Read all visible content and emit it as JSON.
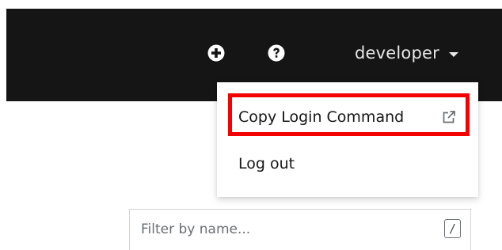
{
  "masthead": {
    "background_color": "#151515",
    "add_icon": "plus-circle-icon",
    "help_icon": "question-circle-icon",
    "user_menu": {
      "username": "developer",
      "caret_icon": "caret-down-icon"
    }
  },
  "user_dropdown": {
    "items": [
      {
        "label": "Copy Login Command",
        "icon": "external-link-icon"
      },
      {
        "label": "Log out"
      }
    ],
    "highlight_color": "#f40000"
  },
  "filter": {
    "placeholder": "Filter by name...",
    "value": "",
    "shortcut_key": "/"
  }
}
